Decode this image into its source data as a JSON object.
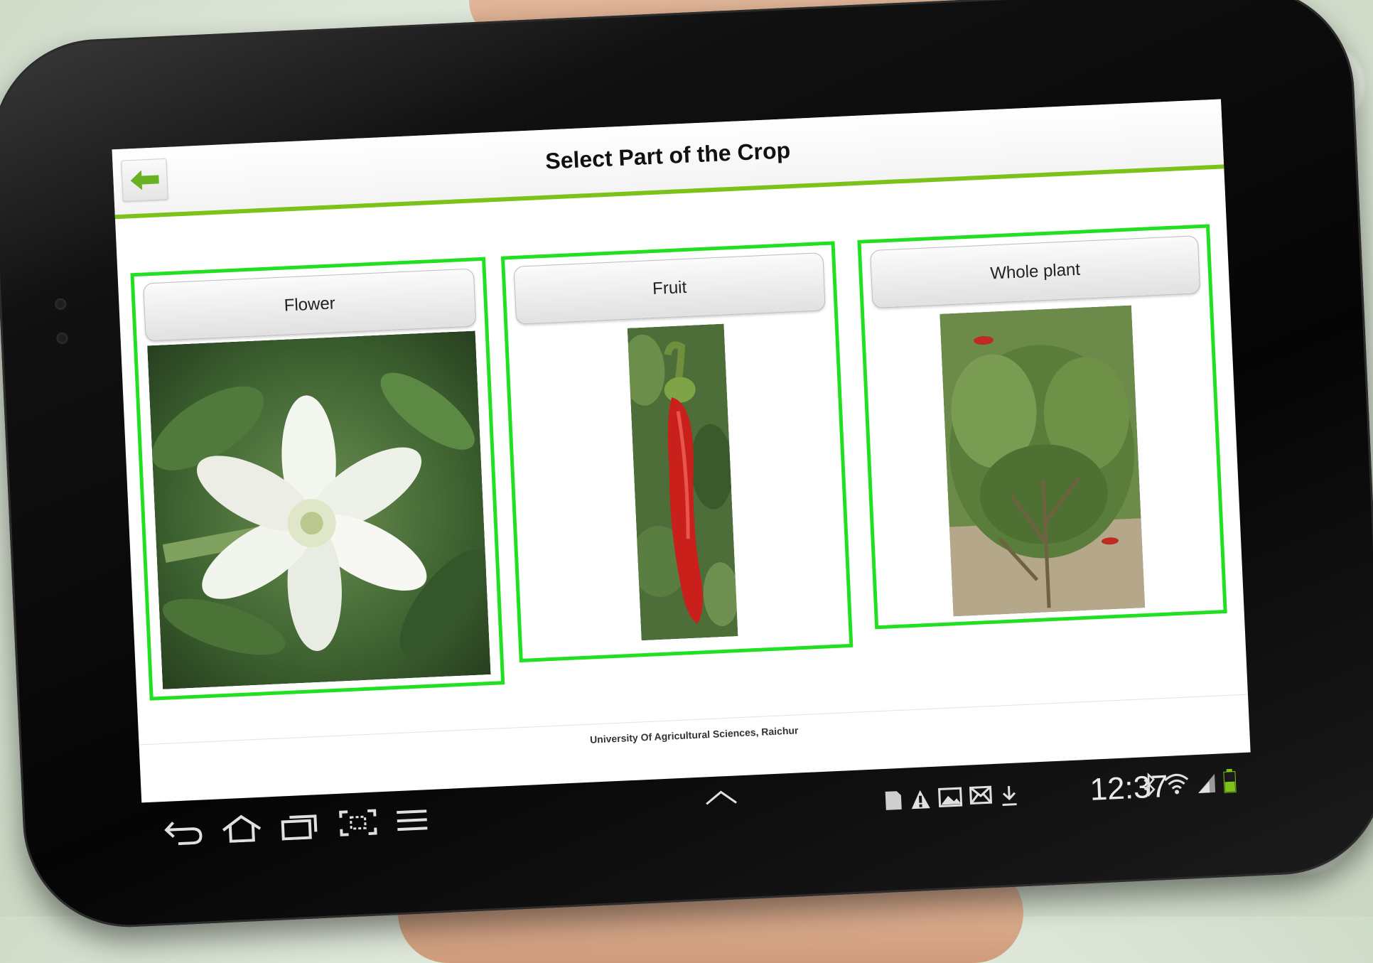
{
  "screen": {
    "title": "Select Part of the Crop",
    "footer": "University Of Agricultural Sciences, Raichur"
  },
  "cards": [
    {
      "label": "Flower",
      "image": "white-chilli-flower"
    },
    {
      "label": "Fruit",
      "image": "red-chilli-fruit"
    },
    {
      "label": "Whole plant",
      "image": "chilli-plant"
    }
  ],
  "status_bar": {
    "time": "12:37",
    "icons": [
      "sd-card-icon",
      "alert-icon",
      "gallery-icon",
      "mail-icon",
      "download-icon",
      "bluetooth-icon",
      "wifi-icon",
      "signal-icon",
      "battery-icon"
    ]
  },
  "nav_bar": [
    "back-icon",
    "home-icon",
    "recent-apps-icon",
    "screenshot-icon",
    "menu-icon"
  ],
  "colors": {
    "accent": "#7cc21a",
    "card_border": "#21e021",
    "back_arrow": "#6ab023"
  }
}
